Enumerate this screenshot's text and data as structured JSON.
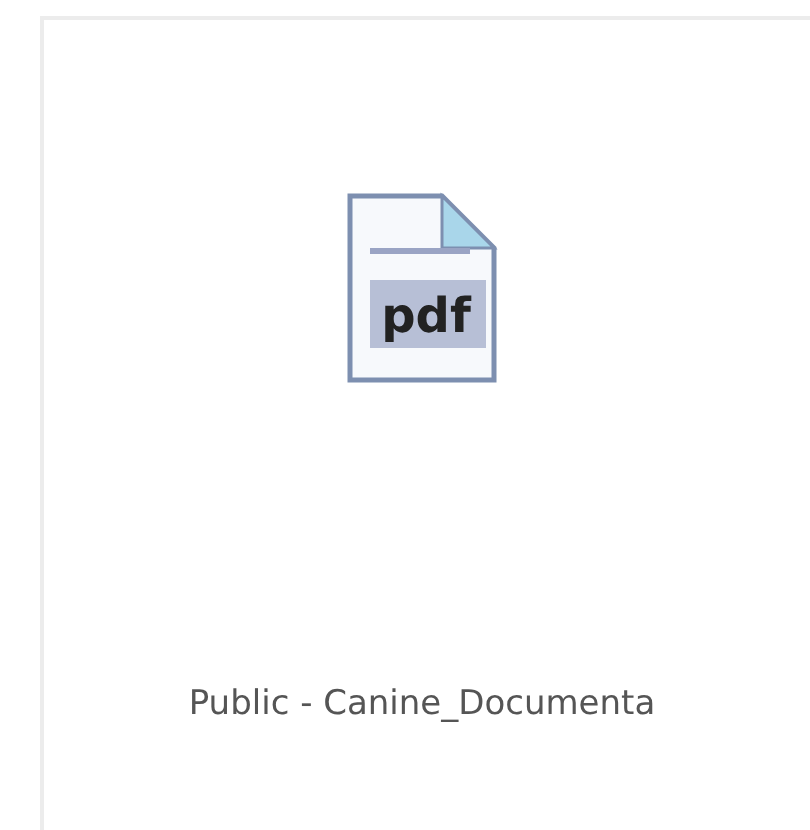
{
  "file_tile": {
    "icon_label": "pdf",
    "name": "Public - Canine_Documenta"
  }
}
